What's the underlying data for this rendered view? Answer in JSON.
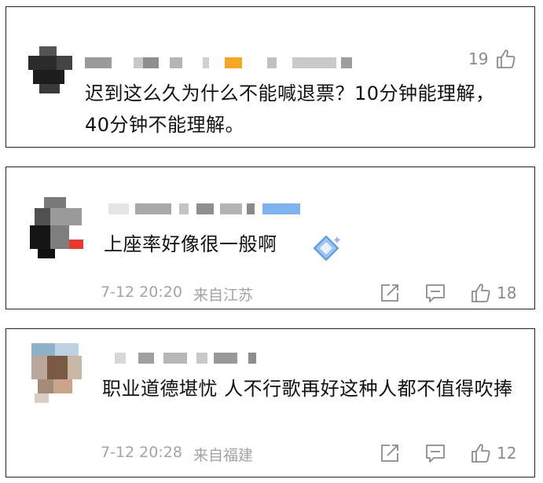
{
  "comments": [
    {
      "text": "迟到这么久为什么不能喊退票？10分钟能理解，40分钟不能理解。",
      "likes": "19"
    },
    {
      "text": "上座率好像很一般啊",
      "time": "7-12 20:20",
      "location": "来自江苏",
      "likes": "18",
      "sticker_icon": "sparkle-diamond-icon"
    },
    {
      "text": "职业道德堪忧 人不行歌再好这种人都不值得吹捧",
      "time": "7-12 20:28",
      "location": "来自福建",
      "likes": "12"
    }
  ],
  "icons": {
    "like": "thumbs-up-icon",
    "share": "share-icon",
    "reply": "comment-icon"
  },
  "colors": {
    "border": "#222222",
    "meta_text": "#a3a3a3",
    "icon": "#8a8a8a",
    "accent_orange": "#f5a623",
    "accent_blue": "#7fb3ef",
    "accent_red": "#e63a2f"
  }
}
